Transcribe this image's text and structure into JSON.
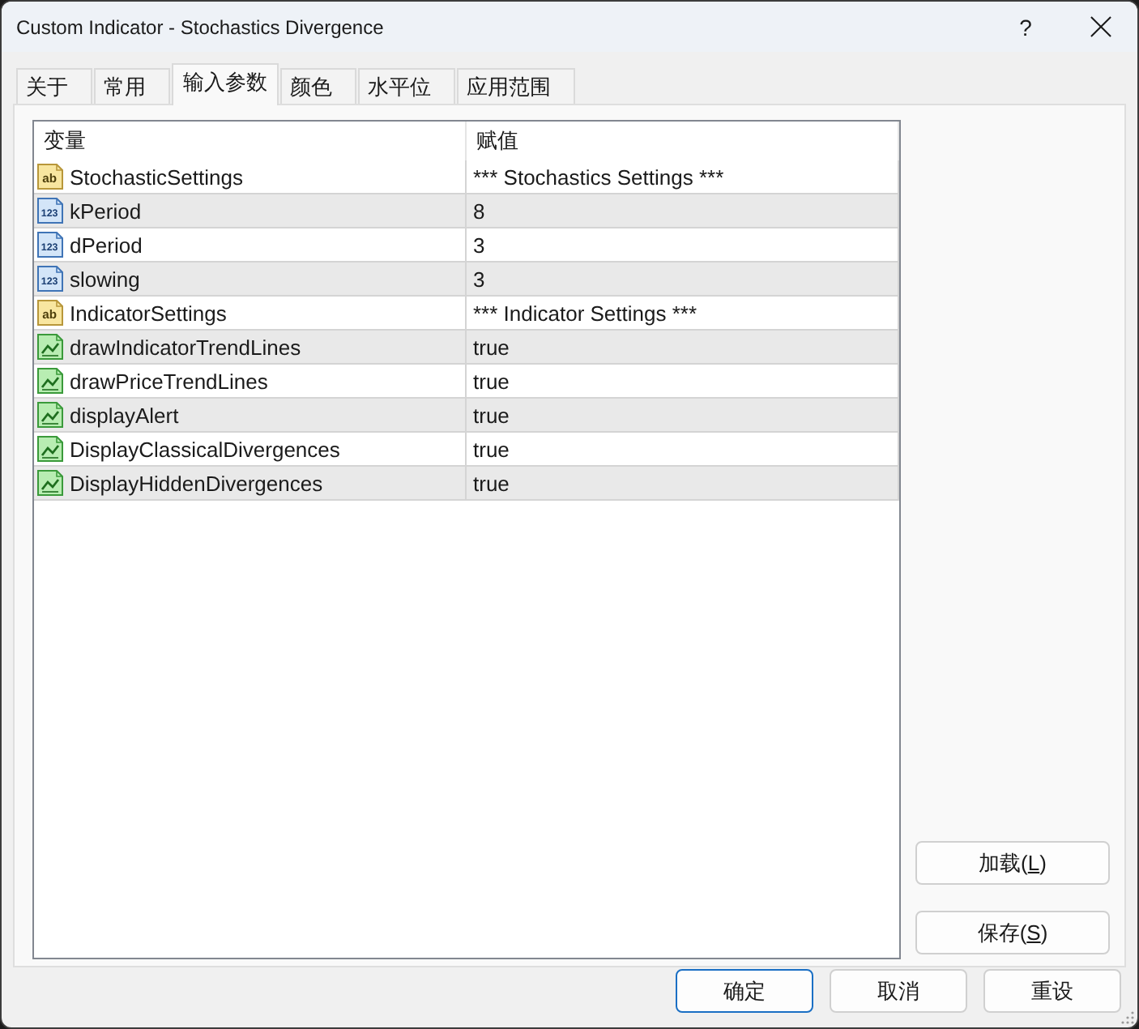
{
  "window": {
    "title": "Custom Indicator - Stochastics Divergence",
    "help_button": "?"
  },
  "tabs": [
    {
      "label": "关于",
      "selected": false
    },
    {
      "label": "常用",
      "selected": false
    },
    {
      "label": "输入参数",
      "selected": true
    },
    {
      "label": "颜色",
      "selected": false
    },
    {
      "label": "水平位",
      "selected": false
    },
    {
      "label": "应用范围",
      "selected": false
    }
  ],
  "inputs_table": {
    "columns": [
      "变量",
      "赋值"
    ],
    "rows": [
      {
        "kind": "string",
        "icon_label": "ab",
        "name": "StochasticSettings",
        "value": "*** Stochastics Settings ***"
      },
      {
        "kind": "int",
        "icon_label": "123",
        "name": "kPeriod",
        "value": "8"
      },
      {
        "kind": "int",
        "icon_label": "123",
        "name": "dPeriod",
        "value": "3"
      },
      {
        "kind": "int",
        "icon_label": "123",
        "name": "slowing",
        "value": "3"
      },
      {
        "kind": "string",
        "icon_label": "ab",
        "name": "IndicatorSettings",
        "value": "*** Indicator Settings ***"
      },
      {
        "kind": "bool",
        "name": "drawIndicatorTrendLines",
        "value": "true"
      },
      {
        "kind": "bool",
        "name": "drawPriceTrendLines",
        "value": "true"
      },
      {
        "kind": "bool",
        "name": "displayAlert",
        "value": "true"
      },
      {
        "kind": "bool",
        "name": "DisplayClassicalDivergences",
        "value": "true"
      },
      {
        "kind": "bool",
        "name": "DisplayHiddenDivergences",
        "value": "true"
      }
    ]
  },
  "side_buttons": [
    {
      "label": "加载(",
      "mnemonic": "L",
      "label_end": ")"
    },
    {
      "label": "保存(",
      "mnemonic": "S",
      "label_end": ")"
    }
  ],
  "dialog_buttons": [
    {
      "label": "确定",
      "focused": true
    },
    {
      "label": "取消",
      "focused": false
    },
    {
      "label": "重设",
      "focused": false
    }
  ]
}
